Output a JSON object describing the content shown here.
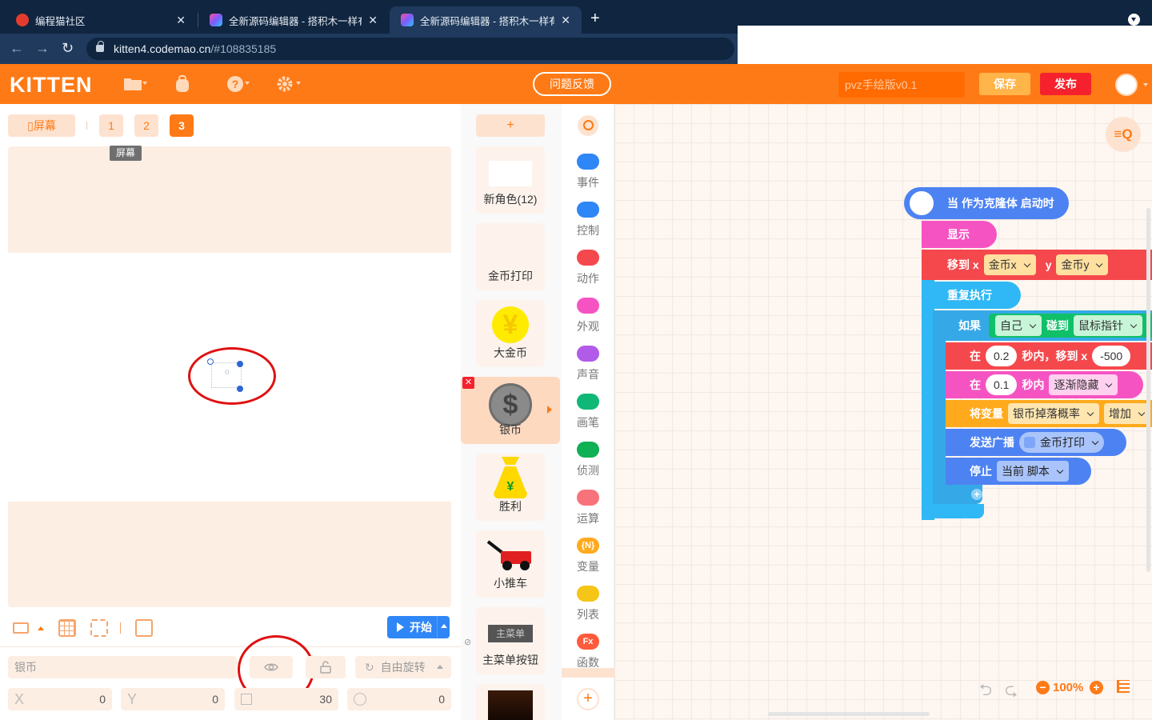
{
  "browser": {
    "tabs": [
      {
        "title": "编程猫社区",
        "active": false
      },
      {
        "title": "全新源码编辑器 - 搭积木一样有趣",
        "active": false
      },
      {
        "title": "全新源码编辑器 - 搭积木一样有趣",
        "active": true
      }
    ],
    "close_glyph": "✕",
    "new_tab_glyph": "+",
    "url_host": "kitten4.codemao.cn",
    "url_path": "/#108835185"
  },
  "header": {
    "logo": "KITTEN",
    "feedback": "问题反馈",
    "project_name": "pvz手绘版v0.1",
    "save": "保存",
    "publish": "发布",
    "icons": [
      "folder-icon",
      "backpack-icon",
      "help-icon",
      "settings-icon"
    ]
  },
  "stage": {
    "screen_button": "屏幕",
    "scenes": [
      "1",
      "2",
      "3"
    ],
    "active_scene": "3",
    "tooltip": "屏幕",
    "sprite_center_label": "o",
    "start_button": "开始"
  },
  "properties": {
    "sprite_name": "银币",
    "rotation_mode": "自由旋转",
    "x_label": "X",
    "x_value": "0",
    "y_label": "Y",
    "y_value": "0",
    "size_value": "30",
    "direction_value": "0"
  },
  "sprites": {
    "add": "+",
    "items": [
      {
        "name": "新角色(12)",
        "thumb": "blank"
      },
      {
        "name": "金币打印",
        "thumb": "none"
      },
      {
        "name": "大金币",
        "thumb": "gold-coin",
        "glyph": "¥"
      },
      {
        "name": "银币",
        "thumb": "silver-coin",
        "glyph": "$",
        "selected": true
      },
      {
        "name": "胜利",
        "thumb": "money-bag",
        "glyph": "¥"
      },
      {
        "name": "小推车",
        "thumb": "cart"
      },
      {
        "name": "主菜单按钮",
        "thumb": "menu-button",
        "thumb_text": "主菜单"
      }
    ],
    "delete_glyph": "✕"
  },
  "categories": [
    {
      "label": "事件",
      "color": "#2f86f6"
    },
    {
      "label": "控制",
      "color": "#2f86f6"
    },
    {
      "label": "动作",
      "color": "#f5484d"
    },
    {
      "label": "外观",
      "color": "#f653c2"
    },
    {
      "label": "声音",
      "color": "#b05ce8"
    },
    {
      "label": "画笔",
      "color": "#10b877"
    },
    {
      "label": "侦测",
      "color": "#10b054"
    },
    {
      "label": "运算",
      "color": "#f7727a"
    },
    {
      "label": "变量",
      "color": "#ffaa1d",
      "icon_text": "{N}"
    },
    {
      "label": "列表",
      "color": "#f5c518"
    },
    {
      "label": "函数",
      "color": "#fe5b3c",
      "icon_text": "Fx"
    }
  ],
  "script": {
    "hat": "当 作为克隆体 启动时",
    "show": "显示",
    "move_to_x": "移到 x",
    "coin_x": "金币x",
    "y_label": "y",
    "coin_y": "金币y",
    "forever": "重复执行",
    "if": "如果",
    "self": "自己",
    "touch": "碰到",
    "mouse_pointer": "鼠标指针",
    "in": "在",
    "secs_val_1": "0.2",
    "secs_move": "秒内，移到 x",
    "x_target": "-500",
    "secs_val_2": "0.1",
    "secs": "秒内",
    "fade_out": "逐渐隐藏",
    "set_var": "将变量",
    "var_name": "银币掉落概率",
    "increase": "增加",
    "broadcast": "发送广播",
    "message": "金币打印",
    "stop": "停止",
    "current_script": "当前 脚本",
    "add_glyph": "+"
  },
  "workspace": {
    "zoom": "100%",
    "zoom_minus": "−",
    "zoom_plus": "+",
    "search_button": "≡Q"
  }
}
